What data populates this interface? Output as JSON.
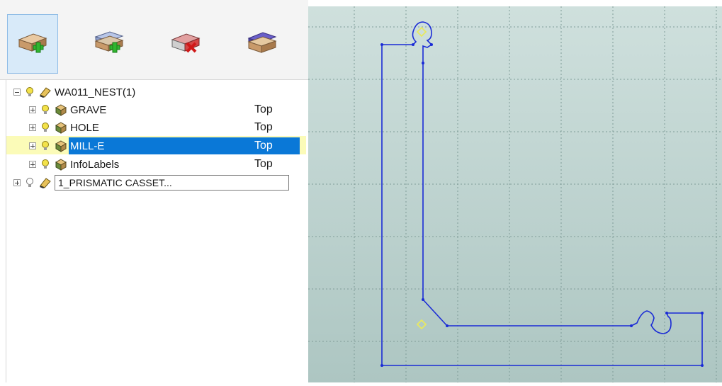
{
  "toolbar": {
    "buttons": [
      {
        "name": "add-part",
        "icon": "block-plus-icon",
        "active": true
      },
      {
        "name": "add-layers",
        "icon": "stacked-block-plus-icon",
        "active": false
      },
      {
        "name": "delete-part",
        "icon": "block-delete-icon",
        "active": false
      },
      {
        "name": "properties",
        "icon": "block-purple-icon",
        "active": false
      }
    ]
  },
  "tree": {
    "root": {
      "label": "WA011_NEST(1)",
      "expanded": true
    },
    "items": [
      {
        "label": "GRAVE",
        "view": "Top",
        "selected": false
      },
      {
        "label": "HOLE",
        "view": "Top",
        "selected": false
      },
      {
        "label": "MILL-E",
        "view": "Top",
        "selected": true
      },
      {
        "label": "InfoLabels",
        "view": "Top",
        "selected": false
      }
    ],
    "second_root": {
      "label": "1_PRISMATIC CASSET...",
      "editing": true
    }
  },
  "viewport": {
    "background": "#bcd2cf",
    "grid_color": "#7f9c98",
    "contour_color": "#1a2bd6",
    "marker_color": "#e8e860"
  }
}
